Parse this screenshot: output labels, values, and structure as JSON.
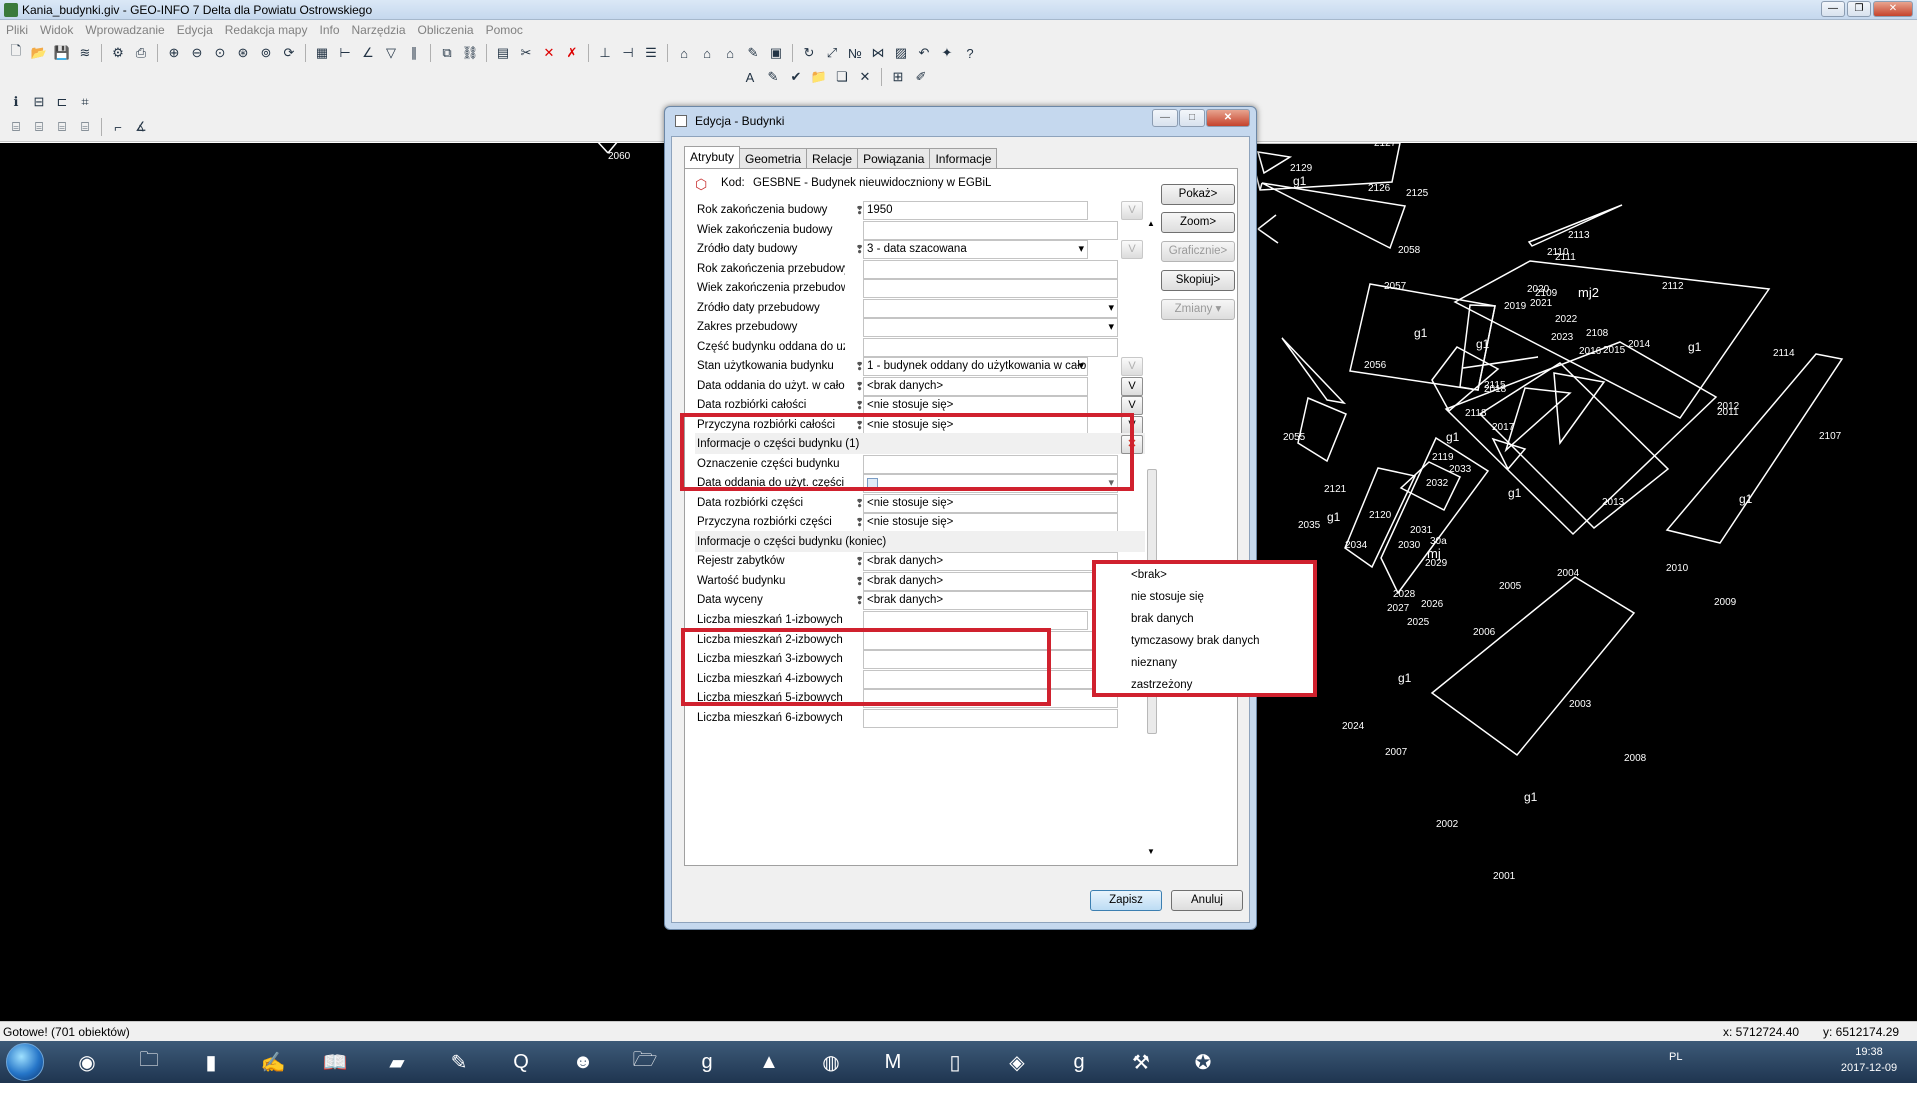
{
  "window": {
    "title": "Kania_budynki.giv - GEO-INFO 7 Delta dla Powiatu Ostrowskiego"
  },
  "menu": [
    "Pliki",
    "Widok",
    "Wprowadzanie",
    "Edycja",
    "Redakcja mapy",
    "Info",
    "Narzędzia",
    "Obliczenia",
    "Pomoc"
  ],
  "dialog": {
    "title": "Edycja - Budynki",
    "tabs": [
      "Atrybuty",
      "Geometria",
      "Relacje",
      "Powiązania",
      "Informacje"
    ],
    "kod_label": "Kod:",
    "kod_value": "GESBNE - Budynek nieuwidoczniony w EGBiL",
    "rows": [
      {
        "label": "Rok zakończenia budowy",
        "value": "1950"
      },
      {
        "label": "Wiek zakończenia budowy",
        "value": ""
      },
      {
        "label": "Źródło daty budowy",
        "value": "3 - data szacowana"
      },
      {
        "label": "Rok zakończenia przebudowy",
        "value": ""
      },
      {
        "label": "Wiek zakończenia przebudowy",
        "value": ""
      },
      {
        "label": "Źródło daty przebudowy",
        "value": ""
      },
      {
        "label": "Zakres przebudowy",
        "value": ""
      },
      {
        "label": "Część budynku oddana do użyt",
        "value": ""
      },
      {
        "label": "Stan użytkowania budynku",
        "value": "1 - budynek oddany do użytkowania w cało"
      },
      {
        "label": "Data oddania do użyt. w całośc",
        "value": "<brak danych>"
      },
      {
        "label": "Data rozbiórki całości",
        "value": "<nie stosuje się>"
      },
      {
        "label": "Przyczyna rozbiórki całości",
        "value": "<nie stosuje się>"
      },
      {
        "label": "Informacje o części budynku (1)",
        "value": ""
      },
      {
        "label": "Oznaczenie części budynku",
        "value": ""
      },
      {
        "label": "Data oddania do użyt. części",
        "value": ""
      },
      {
        "label": "Data rozbiórki części",
        "value": "<nie stosuje się>"
      },
      {
        "label": "Przyczyna rozbiórki części",
        "value": "<nie stosuje się>"
      },
      {
        "label": "Informacje o części budynku (koniec)",
        "value": ""
      },
      {
        "label": "Rejestr zabytków",
        "value": "<brak danych>"
      },
      {
        "label": "Wartość budynku",
        "value": "<brak danych>"
      },
      {
        "label": "Data wyceny",
        "value": "<brak danych>"
      },
      {
        "label": "Liczba mieszkań 1-izbowych",
        "value": ""
      },
      {
        "label": "Liczba mieszkań 2-izbowych",
        "value": ""
      },
      {
        "label": "Liczba mieszkań 3-izbowych",
        "value": ""
      },
      {
        "label": "Liczba mieszkań 4-izbowych",
        "value": ""
      },
      {
        "label": "Liczba mieszkań 5-izbowych",
        "value": ""
      },
      {
        "label": "Liczba mieszkań 6-izbowych",
        "value": ""
      }
    ],
    "v_label": "V",
    "side_buttons": [
      "Pokaż>",
      "Zoom>",
      "Graficznie>",
      "Skopiuj>",
      "Zmiany"
    ],
    "save": "Zapisz",
    "cancel": "Anuluj"
  },
  "dropdown_options": [
    "<brak>",
    "nie stosuje się",
    "brak danych",
    "tymczasowy brak danych",
    "nieznany",
    "zastrzeżony"
  ],
  "map_labels": [
    "2060",
    "2129",
    "g1",
    "2127",
    "2126",
    "2125",
    "2058",
    "2113",
    "2110",
    "2111",
    "2057",
    "2109",
    "mj2",
    "2112",
    "2020",
    "2021",
    "2019",
    "2022",
    "g1",
    "g1",
    "2023",
    "2108",
    "2016",
    "2014",
    "2015",
    "g1",
    "2114",
    "2056",
    "2115",
    "2018",
    "2118",
    "2017",
    "2012",
    "2011",
    "2107",
    "2055",
    "g1",
    "2119",
    "2033",
    "2032",
    "g1",
    "2013",
    "g1",
    "2121",
    "2035",
    "g1",
    "2120",
    "2034",
    "2031",
    "2030",
    "30a",
    "mj",
    "2029",
    "2005",
    "2004",
    "2010",
    "2009",
    "2028",
    "2027",
    "2026",
    "2025",
    "2006",
    "g1",
    "2024",
    "2007",
    "2003",
    "2008",
    "g1",
    "2002",
    "2001"
  ],
  "status": {
    "text": "Gotowe! (701 obiektów)",
    "x": "x: 5712724.40",
    "y": "y: 6512174.29"
  },
  "tray": {
    "lang": "PL",
    "time": "19:38",
    "date": "2017-12-09"
  },
  "colors": {
    "highlight": "#d0212e",
    "map_bg": "#000000",
    "map_lines": "#ffffff"
  }
}
